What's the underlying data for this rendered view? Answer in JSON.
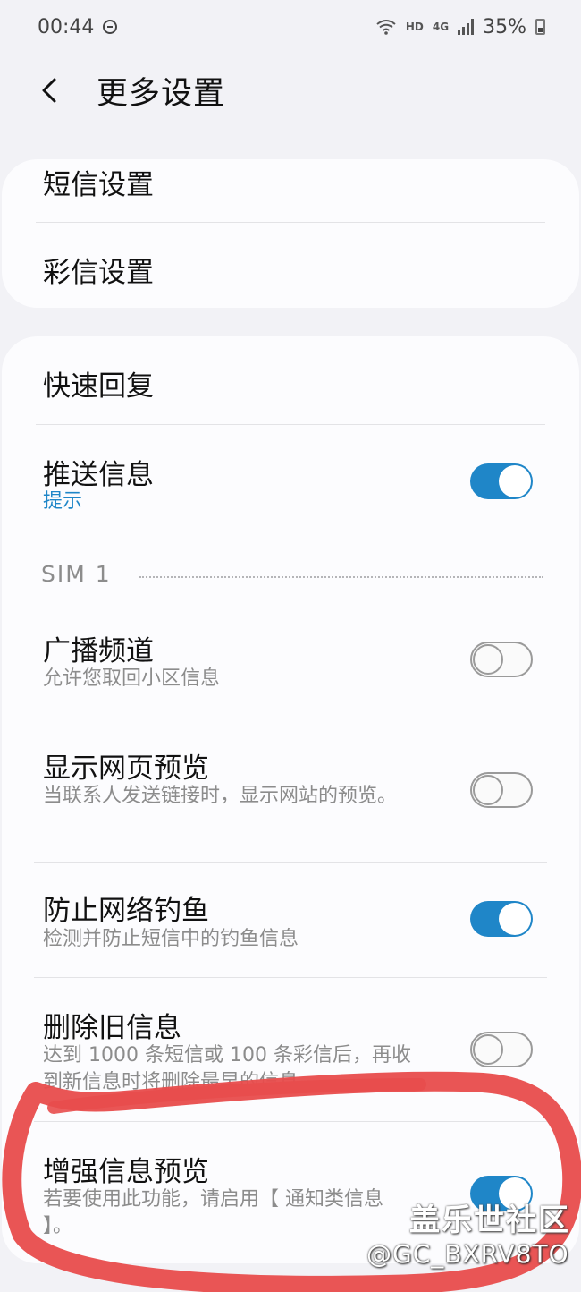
{
  "status_bar": {
    "time": "00:44",
    "network_hd": "HD",
    "network_4g": "4G",
    "battery": "35%"
  },
  "header": {
    "title": "更多设置"
  },
  "group1": {
    "items": [
      {
        "title": "短信设置"
      },
      {
        "title": "彩信设置"
      }
    ]
  },
  "group2": {
    "quick_reply": {
      "title": "快速回复"
    },
    "push_messages": {
      "title": "推送信息",
      "subtitle": "提示",
      "toggle": "on"
    },
    "section_label": "SIM 1",
    "cell_broadcast": {
      "title": "广播频道",
      "subtitle": "允许您取回小区信息",
      "toggle": "off"
    },
    "web_preview": {
      "title": "显示网页预览",
      "subtitle": "当联系人发送链接时，显示网站的预览。",
      "toggle": "off"
    },
    "anti_phishing": {
      "title": "防止网络钓鱼",
      "subtitle": "检测并防止短信中的钓鱼信息",
      "toggle": "on"
    },
    "delete_old": {
      "title": "删除旧信息",
      "subtitle": "达到 1000 条短信或 100 条彩信后，再收到新信息时将删除最早的信息。",
      "toggle": "off"
    },
    "enhanced_preview": {
      "title": "增强信息预览",
      "subtitle": "若要使用此功能，请启用【 通知类信息 】。",
      "toggle": "on"
    }
  },
  "watermark": {
    "site": "盖乐世社区",
    "user": "@GC_BXRV8TO"
  },
  "colors": {
    "accent": "#1f86c8",
    "annotation": "#e84c4c"
  }
}
